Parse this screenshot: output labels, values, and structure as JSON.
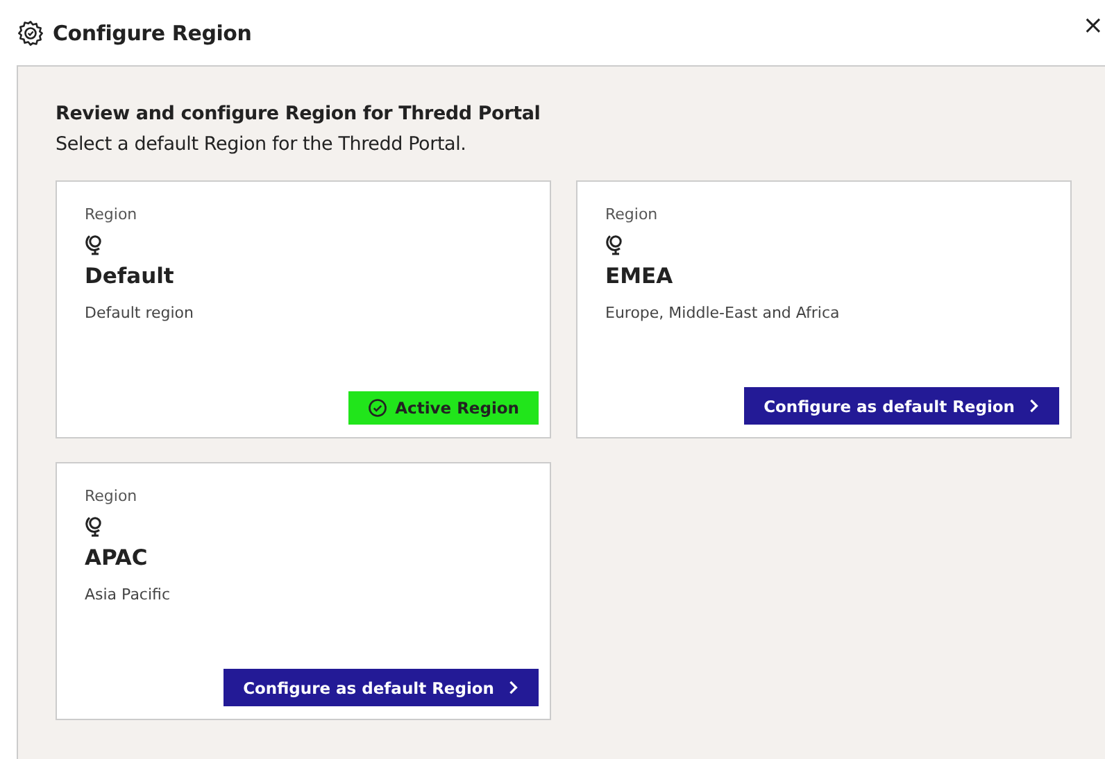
{
  "dialog": {
    "title": "Configure Region",
    "close": "×"
  },
  "intro": {
    "heading": "Review and configure Region for Thredd Portal",
    "text": "Select a default Region for the Thredd Portal."
  },
  "regions": [
    {
      "label": "Region",
      "name": "Default",
      "description": "Default region",
      "active": true,
      "action": "Active Region"
    },
    {
      "label": "Region",
      "name": "EMEA",
      "description": "Europe, Middle-East and Africa",
      "active": false,
      "action": "Configure as default Region"
    },
    {
      "label": "Region",
      "name": "APAC",
      "description": "Asia Pacific",
      "active": false,
      "action": "Configure as default Region"
    }
  ]
}
